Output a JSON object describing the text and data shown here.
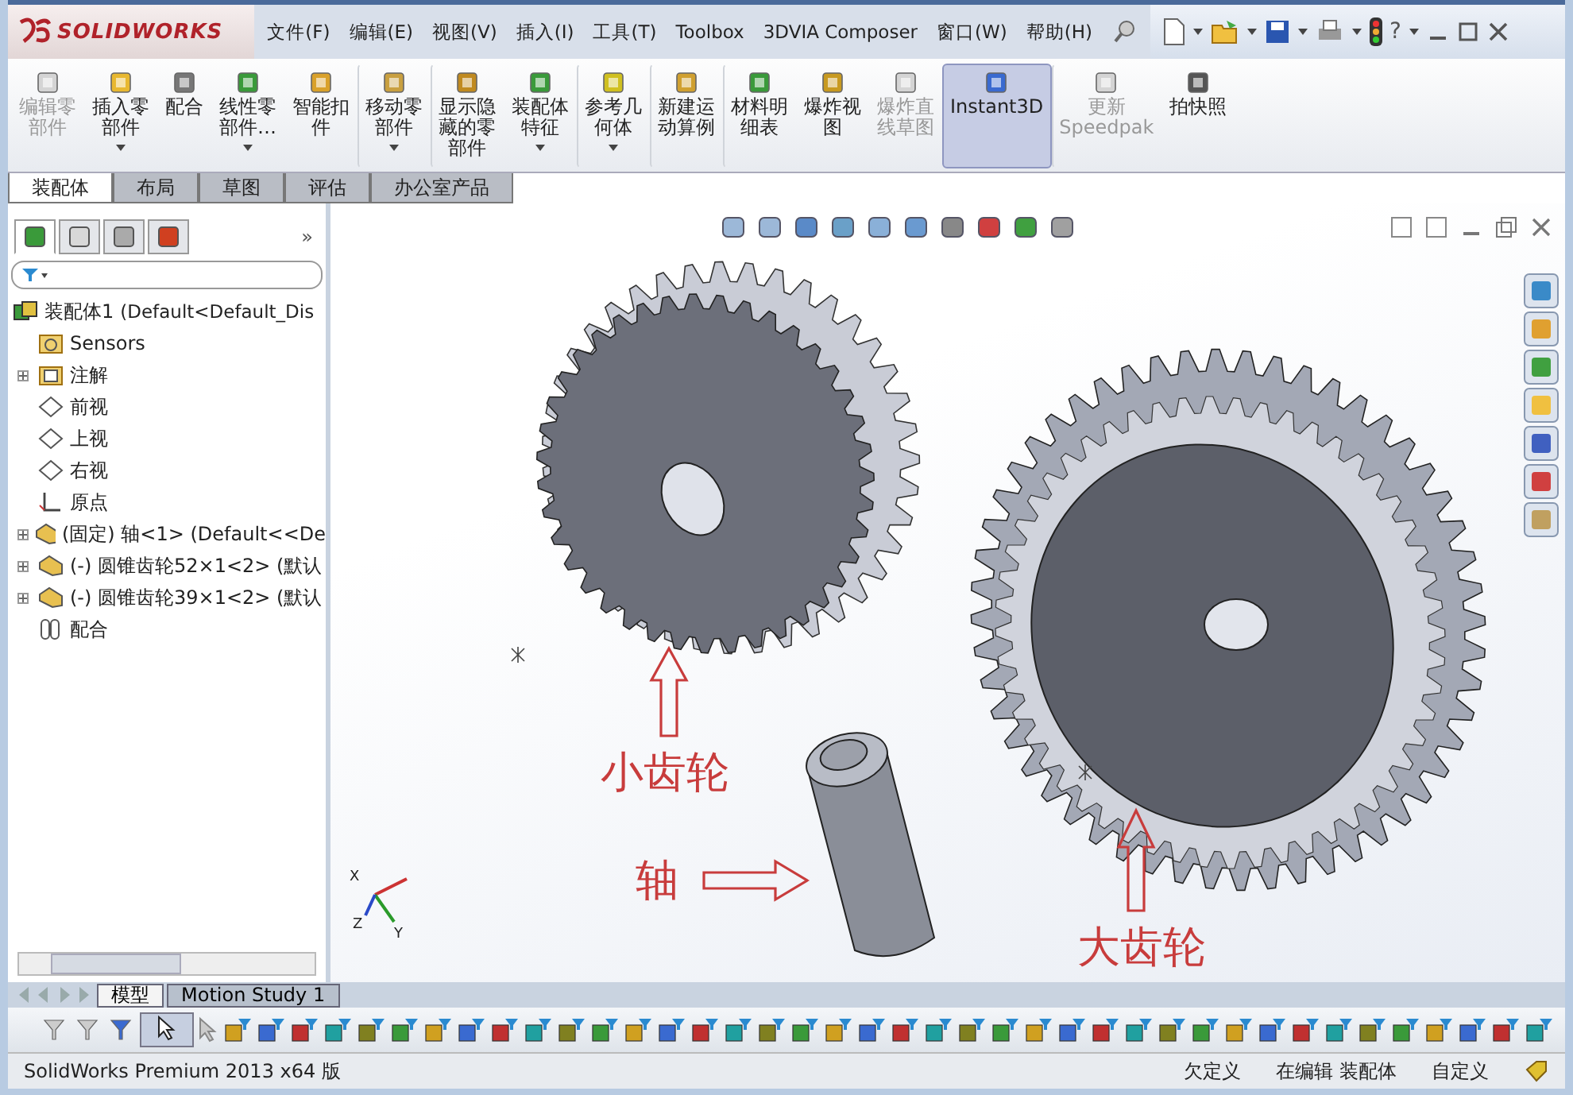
{
  "title_bar": {
    "brand": "SOLIDWORKS",
    "menu": [
      "文件(F)",
      "编辑(E)",
      "视图(V)",
      "插入(I)",
      "工具(T)",
      "Toolbox",
      "3DVIA Composer",
      "窗口(W)",
      "帮助(H)"
    ],
    "help": "?"
  },
  "commands": [
    {
      "label": [
        "编辑零",
        "部件"
      ],
      "disabled": true,
      "dropdown": false,
      "selected": false
    },
    {
      "label": [
        "插入零",
        "部件"
      ],
      "disabled": false,
      "dropdown": true,
      "selected": false
    },
    {
      "label": [
        "配合"
      ],
      "disabled": false,
      "dropdown": false,
      "selected": false
    },
    {
      "label": [
        "线性零",
        "部件…"
      ],
      "disabled": false,
      "dropdown": true,
      "selected": false
    },
    {
      "label": [
        "智能扣",
        "件"
      ],
      "disabled": false,
      "dropdown": false,
      "selected": false
    },
    {
      "label": [
        "移动零",
        "部件"
      ],
      "disabled": false,
      "dropdown": true,
      "selected": false
    },
    {
      "label": [
        "显示隐",
        "藏的零",
        "部件"
      ],
      "disabled": false,
      "dropdown": false,
      "selected": false
    },
    {
      "label": [
        "装配体",
        "特征"
      ],
      "disabled": false,
      "dropdown": true,
      "selected": false
    },
    {
      "label": [
        "参考几",
        "何体"
      ],
      "disabled": false,
      "dropdown": true,
      "selected": false
    },
    {
      "label": [
        "新建运",
        "动算例"
      ],
      "disabled": false,
      "dropdown": false,
      "selected": false
    },
    {
      "label": [
        "材料明",
        "细表"
      ],
      "disabled": false,
      "dropdown": false,
      "selected": false
    },
    {
      "label": [
        "爆炸视",
        "图"
      ],
      "disabled": false,
      "dropdown": false,
      "selected": false
    },
    {
      "label": [
        "爆炸直",
        "线草图"
      ],
      "disabled": true,
      "dropdown": false,
      "selected": false
    },
    {
      "label": [
        "Instant3D"
      ],
      "disabled": false,
      "dropdown": false,
      "selected": true
    },
    {
      "label": [
        "更新",
        "Speedpak"
      ],
      "disabled": true,
      "dropdown": false,
      "selected": false
    },
    {
      "label": [
        "拍快照"
      ],
      "disabled": false,
      "dropdown": false,
      "selected": false
    }
  ],
  "tabs": [
    {
      "label": "装配体",
      "selected": true
    },
    {
      "label": "布局",
      "selected": false
    },
    {
      "label": "草图",
      "selected": false
    },
    {
      "label": "评估",
      "selected": false
    },
    {
      "label": "办公室产品",
      "selected": false
    }
  ],
  "panel_tabs": [
    {
      "selected": true
    },
    {
      "selected": false
    },
    {
      "selected": false
    },
    {
      "selected": false
    }
  ],
  "panel_more": "»",
  "tree": {
    "root": {
      "name": "装配体1",
      "config": "(Default<Default_Dis"
    },
    "children": [
      {
        "kind": "sensor",
        "label": "Sensors",
        "expandable": false
      },
      {
        "kind": "annotation",
        "label": "注解",
        "expandable": true
      },
      {
        "kind": "plane",
        "label": "前视",
        "expandable": false
      },
      {
        "kind": "plane",
        "label": "上视",
        "expandable": false
      },
      {
        "kind": "plane",
        "label": "右视",
        "expandable": false
      },
      {
        "kind": "origin",
        "label": "原点",
        "expandable": false
      },
      {
        "kind": "part",
        "label": "(固定) 轴<1> (Default<<De",
        "expandable": true
      },
      {
        "kind": "part",
        "label": "(-) 圆锥齿轮52×1<2> (默认",
        "expandable": true
      },
      {
        "kind": "part",
        "label": "(-) 圆锥齿轮39×1<2> (默认",
        "expandable": true
      },
      {
        "kind": "mates",
        "label": "配合",
        "expandable": false
      }
    ]
  },
  "graphics": {
    "labels": {
      "small_gear": "小齿轮",
      "shaft": "轴",
      "large_gear": "大齿轮"
    },
    "triad": {
      "x": "X",
      "y": "Y",
      "z": "Z"
    }
  },
  "bottom_tabs": [
    {
      "label": "模型",
      "selected": true
    },
    {
      "label": "Motion Study 1",
      "selected": false
    }
  ],
  "select_tool": {
    "selected": true
  },
  "status_bar": {
    "product": "SolidWorks Premium 2013 x64 版",
    "definition": "欠定义",
    "mode": "在编辑 装配体",
    "units": "自定义"
  }
}
